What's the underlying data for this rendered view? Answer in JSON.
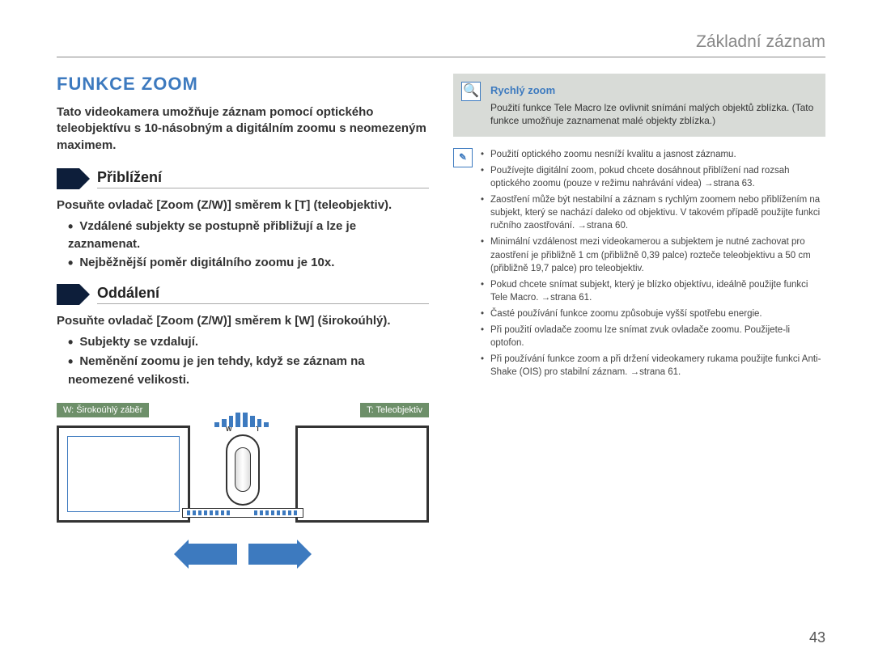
{
  "header": {
    "title": "Základní záznam"
  },
  "left": {
    "main_title": "FUNKCE ZOOM",
    "intro": "Tato videokamera umožňuje záznam pomocí optického teleobjektívu s 10-násobným a digitálním zoomu s neomezeným maximem.",
    "sub1": {
      "heading": "Přiblížení"
    },
    "sub1_text": "Posuňte ovladač [Zoom (Z/W)] směrem k [T] (teleobjektiv).",
    "sub1_bullets": [
      "Vzdálené subjekty se postupně přibližují a lze je zaznamenat.",
      "Nejběžnější poměr digitálního zoomu je 10x."
    ],
    "sub2": {
      "heading": "Oddálení"
    },
    "sub2_text": "Posuňte ovladač [Zoom (Z/W)] směrem k [W] (širokoúhlý).",
    "sub2_bullets": [
      "Subjekty se vzdalují.",
      "Neměnění zoomu je jen tehdy, když se záznam na neomezené velikosti."
    ],
    "dia": {
      "label_w": "W: Širokoúhlý záběr",
      "label_t": "T: Teleobjektiv",
      "w_small": "W",
      "t_small": "T"
    }
  },
  "right": {
    "note": {
      "title": "Rychlý zoom",
      "body": "Použití funkce Tele Macro lze ovlivnit snímání malých objektů zblízka. (Tato funkce umožňuje zaznamenat malé objekty zblízka.)"
    },
    "tips": [
      "Použití optického zoomu nesníží kvalitu a jasnost záznamu.",
      "Používejte digitální zoom, pokud chcete dosáhnout přiblížení nad rozsah optického zoomu (pouze v režimu nahrávání videa) →strana 63.",
      "Zaostření může být nestabilní a záznam s rychlým zoomem nebo přiblížením na subjekt, který se nachází daleko od objektivu. V takovém případě použijte funkci ručního zaostřování. →strana 60.",
      "Minimální vzdálenost mezi videokamerou a subjektem je nutné zachovat pro zaostření je přibližně 1 cm (přibližně 0,39 palce) rozteče teleobjektivu a 50 cm (přibližně 19,7 palce) pro teleobjektiv.",
      "Pokud chcete snímat subjekt, který je blízko objektívu, ideálně použijte funkci Tele Macro. →strana 61.",
      "Časté používání funkce zoomu způsobuje vyšší spotřebu energie.",
      "Při použití ovladače zoomu lze snímat zvuk ovladače zoomu. Použijete-li optofon.",
      "Při používání funkce zoom a při držení videokamery rukama použijte funkci Anti-Shake (OIS) pro stabilní záznam. →strana 61."
    ]
  },
  "page_number": "43"
}
